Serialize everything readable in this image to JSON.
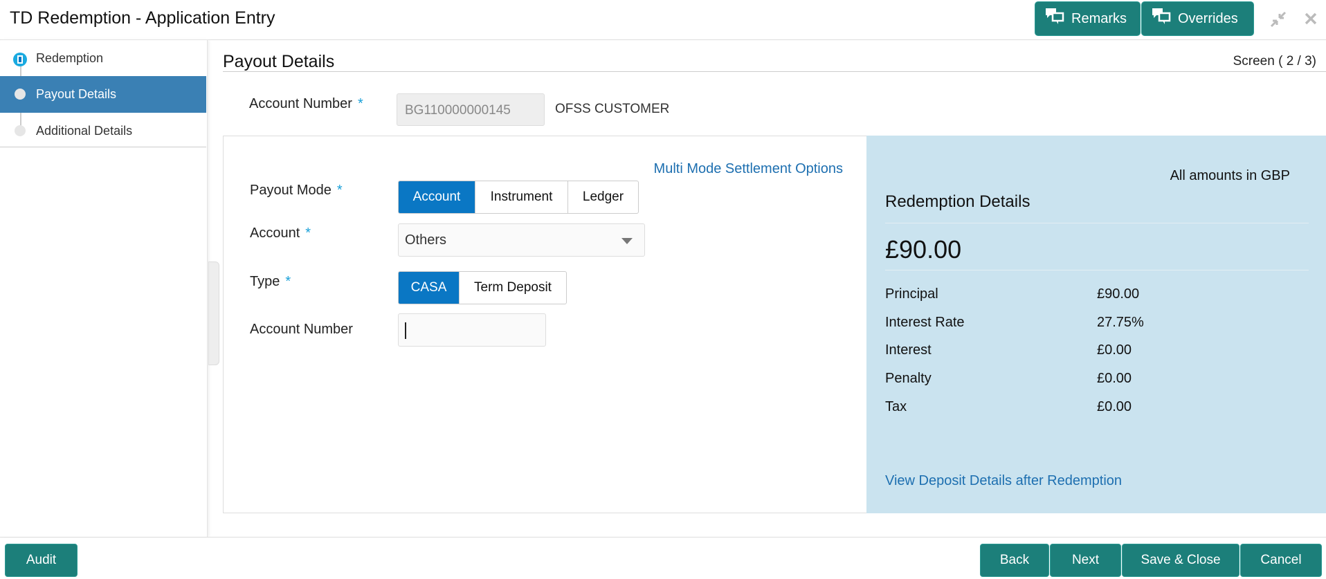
{
  "header": {
    "title": "TD Redemption - Application Entry",
    "remarks": "Remarks",
    "overrides": "Overrides"
  },
  "sidebar": {
    "items": [
      {
        "label": "Redemption",
        "state": "done"
      },
      {
        "label": "Payout Details",
        "state": "active"
      },
      {
        "label": "Additional Details",
        "state": "pending"
      }
    ]
  },
  "page": {
    "title": "Payout Details",
    "screen": "Screen ( 2 / 3)"
  },
  "account": {
    "label": "Account Number",
    "value": "BG110000000145",
    "customer": "OFSS CUSTOMER"
  },
  "form": {
    "multi_mode_link": "Multi Mode Settlement Options",
    "payout_mode": {
      "label": "Payout Mode",
      "options": [
        "Account",
        "Instrument",
        "Ledger"
      ],
      "selected": "Account"
    },
    "account": {
      "label": "Account",
      "value": "Others"
    },
    "type": {
      "label": "Type",
      "options": [
        "CASA",
        "Term Deposit"
      ],
      "selected": "CASA"
    },
    "account_number": {
      "label": "Account Number",
      "value": ""
    }
  },
  "summary": {
    "currency_note": "All amounts in GBP",
    "title": "Redemption Details",
    "total": "£90.00",
    "rows": [
      {
        "label": "Principal",
        "value": "£90.00"
      },
      {
        "label": "Interest Rate",
        "value": "27.75%"
      },
      {
        "label": "Interest",
        "value": "£0.00"
      },
      {
        "label": "Penalty",
        "value": "£0.00"
      },
      {
        "label": "Tax",
        "value": "£0.00"
      }
    ],
    "link": "View Deposit Details after Redemption"
  },
  "footer": {
    "audit": "Audit",
    "back": "Back",
    "next": "Next",
    "save_close": "Save & Close",
    "cancel": "Cancel"
  },
  "colors": {
    "primary": "#1c7f7a",
    "selected": "#0a77c4",
    "sidebar_active": "#3a80b4",
    "summary_bg": "#cae3ef"
  }
}
